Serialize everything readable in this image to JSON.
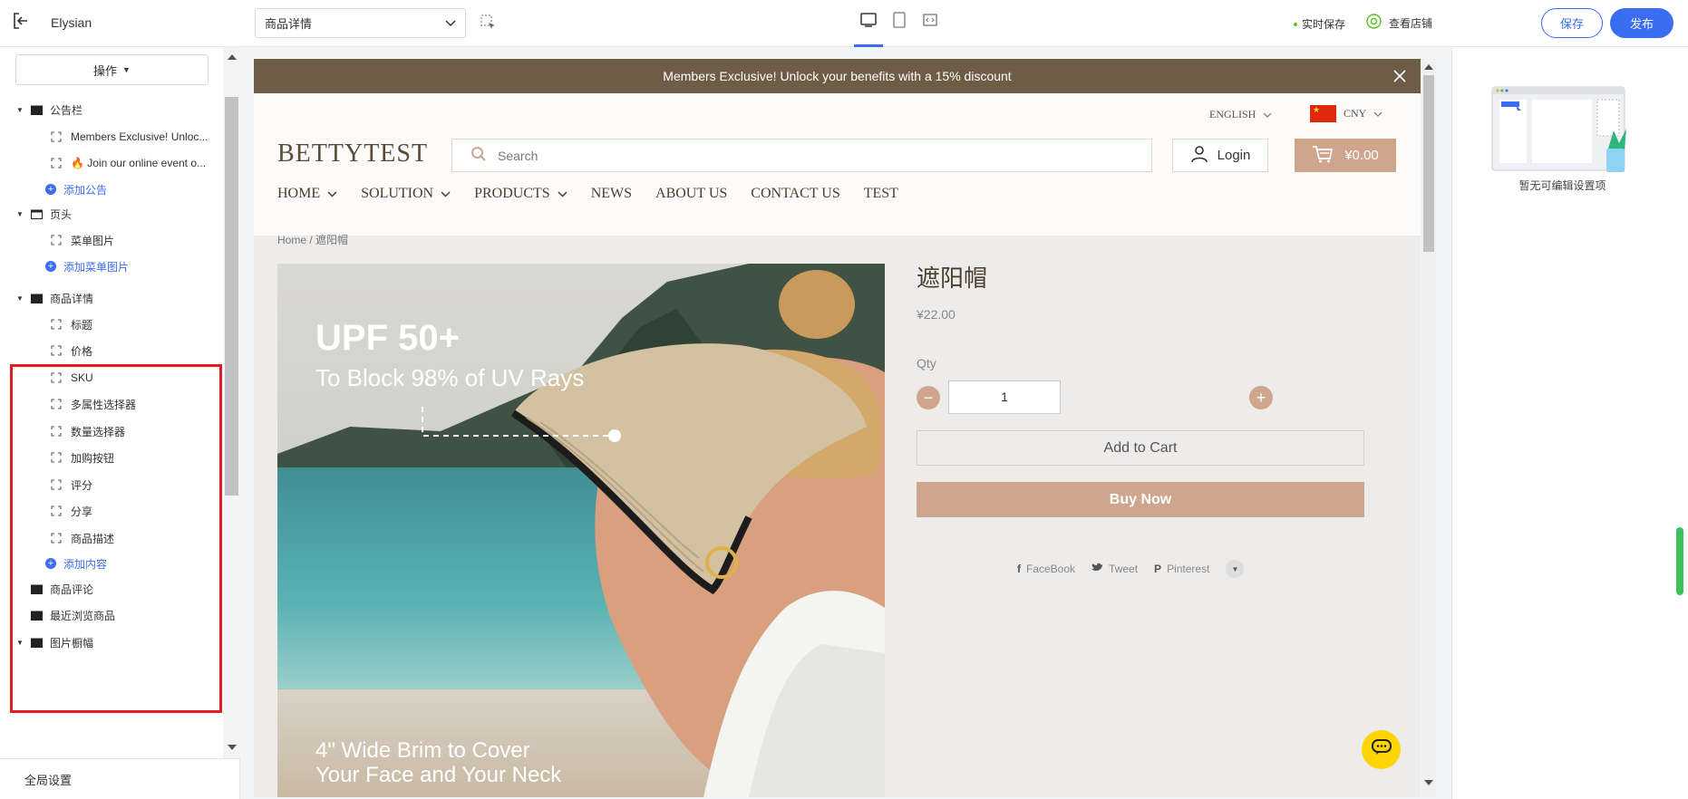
{
  "topbar": {
    "app_name": "Elysian",
    "page_select": "商品详情",
    "save_state": "实时保存",
    "view_store": "查看店铺",
    "save_label": "保存",
    "publish_label": "发布"
  },
  "sidebar": {
    "ops_label": "操作",
    "global_settings": "全局设置",
    "rows": [
      {
        "type": "group",
        "label": "公告栏",
        "expanded": true,
        "icon": "folder-icon"
      },
      {
        "type": "child",
        "label": "Members Exclusive! Unloc..."
      },
      {
        "type": "child",
        "label": "🔥 Join our online event o..."
      },
      {
        "type": "add",
        "label": "添加公告"
      },
      {
        "type": "group",
        "label": "页头",
        "expanded": true,
        "icon": "header-icon"
      },
      {
        "type": "child",
        "label": "菜单图片"
      },
      {
        "type": "add",
        "label": "添加菜单图片"
      },
      {
        "type": "group",
        "label": "商品详情",
        "expanded": true,
        "icon": "section-icon"
      },
      {
        "type": "child",
        "label": "标题"
      },
      {
        "type": "child",
        "label": "价格"
      },
      {
        "type": "child",
        "label": "SKU"
      },
      {
        "type": "child",
        "label": "多属性选择器"
      },
      {
        "type": "child",
        "label": "数量选择器"
      },
      {
        "type": "child",
        "label": "加购按钮"
      },
      {
        "type": "child",
        "label": "评分"
      },
      {
        "type": "child",
        "label": "分享"
      },
      {
        "type": "child",
        "label": "商品描述"
      },
      {
        "type": "add",
        "label": "添加内容"
      },
      {
        "type": "group",
        "label": "商品评论",
        "expanded": false,
        "icon": "section-icon"
      },
      {
        "type": "group",
        "label": "最近浏览商品",
        "expanded": false,
        "icon": "section-icon"
      },
      {
        "type": "group",
        "label": "图片橱幅",
        "expanded": true,
        "icon": "folder-icon"
      }
    ]
  },
  "store": {
    "announcement": "Members Exclusive! Unlock your benefits with a 15% discount",
    "language": "ENGLISH",
    "currency": "CNY",
    "logo": "BETTYTEST",
    "search_placeholder": "Search",
    "login": "Login",
    "cart_total": "¥0.00",
    "nav": [
      {
        "label": "HOME",
        "dropdown": true
      },
      {
        "label": "SOLUTION",
        "dropdown": true
      },
      {
        "label": "PRODUCTS",
        "dropdown": true
      },
      {
        "label": "NEWS",
        "dropdown": false
      },
      {
        "label": "ABOUT US",
        "dropdown": false
      },
      {
        "label": "CONTACT US",
        "dropdown": false
      },
      {
        "label": "TEST",
        "dropdown": false
      }
    ],
    "breadcrumb": "Home / 遮阳帽",
    "product": {
      "image_text_1": "UPF 50+",
      "image_text_2": "To Block 98% of UV Rays",
      "image_text_3": "4\" Wide Brim to Cover",
      "image_text_4": "Your Face and Your Neck",
      "title": "遮阳帽",
      "price": "¥22.00",
      "qty_label": "Qty",
      "qty_value": "1",
      "add_to_cart": "Add to Cart",
      "buy_now": "Buy Now",
      "share": [
        "FaceBook",
        "Tweet",
        "Pinterest"
      ]
    }
  },
  "rightpanel": {
    "empty_text": "暂无可编辑设置项"
  },
  "colors": {
    "accent": "#3a6cf4",
    "announcement_bg": "#6e5d46",
    "button_tan": "#cfa58e",
    "highlight_red": "#e51c23"
  }
}
